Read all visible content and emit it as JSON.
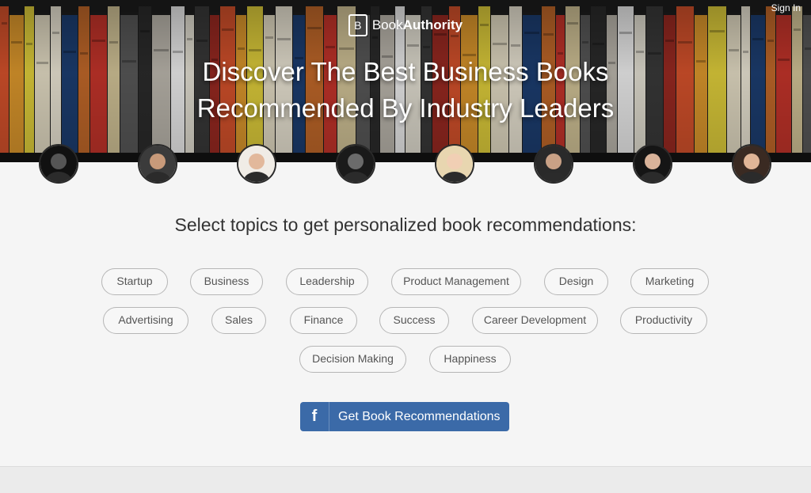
{
  "header": {
    "brand_mark": "B",
    "brand_part1": "Book",
    "brand_part2": "Authority",
    "sign_in": "Sign In",
    "headline_line1": "Discover The Best Business Books",
    "headline_line2": "Recommended By Industry Leaders"
  },
  "avatars": [
    {
      "name": "avatar-1",
      "tone": "#555555",
      "bg": "#111111"
    },
    {
      "name": "avatar-2",
      "tone": "#c89a7a",
      "bg": "#3b3b3b"
    },
    {
      "name": "avatar-3",
      "tone": "#e2b89b",
      "bg": "#f0ece6"
    },
    {
      "name": "avatar-4",
      "tone": "#6b6b6b",
      "bg": "#1a1a1a"
    },
    {
      "name": "avatar-5",
      "tone": "#f1cfb4",
      "bg": "#e8d6b0"
    },
    {
      "name": "avatar-6",
      "tone": "#c9a186",
      "bg": "#2a2a2a"
    },
    {
      "name": "avatar-7",
      "tone": "#d9b39a",
      "bg": "#151515"
    },
    {
      "name": "avatar-8",
      "tone": "#e0b597",
      "bg": "#3a2a22"
    }
  ],
  "topics": {
    "subtitle": "Select topics to get personalized book recommendations:",
    "items": [
      "Startup",
      "Business",
      "Leadership",
      "Product Management",
      "Design",
      "Marketing",
      "Advertising",
      "Sales",
      "Finance",
      "Success",
      "Career Development",
      "Productivity",
      "Decision Making",
      "Happiness"
    ]
  },
  "cta": {
    "icon": "f",
    "label": "Get Book Recommendations",
    "color": "#3b6aa8"
  }
}
